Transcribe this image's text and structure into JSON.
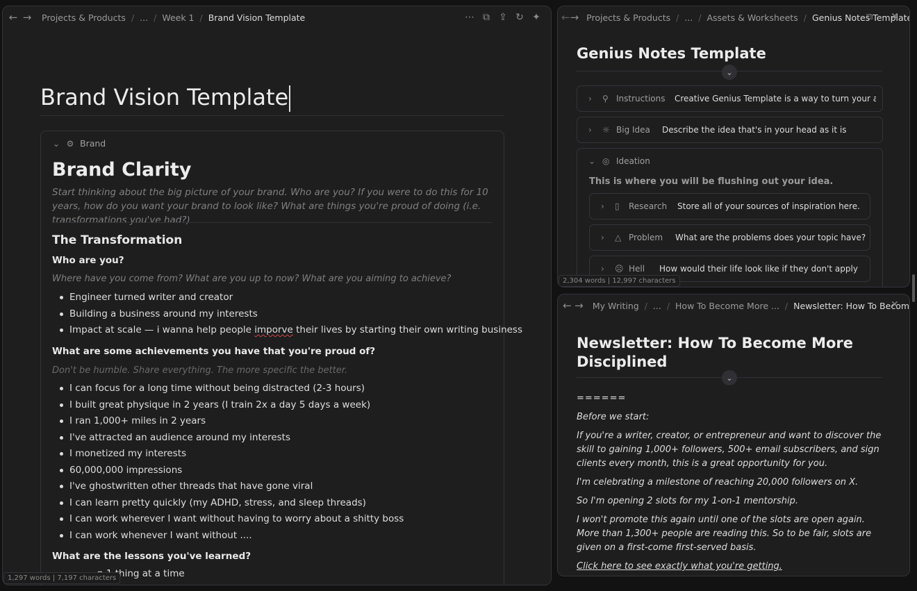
{
  "left": {
    "breadcrumb": [
      "Projects & Products",
      "...",
      "Week 1",
      "Brand Vision Template"
    ],
    "title": "Brand Vision Template",
    "callout_label": "Brand",
    "heading": "Brand Clarity",
    "intro": "Start thinking about the big picture of your brand. Who are you? If you were to do this for 10 years, how do you want your brand to look like? What are things you're proud of doing (i.e. transformations you've had?)",
    "section": "The Transformation",
    "q1": "Who are you?",
    "q1_hint": "Where have you come from? What are you up to now? What are you aiming to achieve?",
    "q1_items": [
      "Engineer turned writer and creator",
      "Building a business around my interests",
      "Impact at scale — i wanna help people imporve their lives by starting their own writing business"
    ],
    "q2": "What are some achievements you have that you're proud of?",
    "q2_hint": "Don't be humble. Share everything. The more specific the better.",
    "q2_items": [
      "I can focus for a long time without being distracted (2-3 hours)",
      "I built great physique in 2 years (I train 2x a day 5 days a week)",
      "I ran 1,000+ miles in 2 years",
      "I've attracted an audience around my interests",
      "I monetized my interests",
      "60,000,000 impressions",
      "I've ghostwritten other threads that have gone viral",
      "I can learn pretty quickly (my ADHD, stress, and sleep threads)",
      "I can work wherever I want without having to worry about a shitty boss",
      "I can work whenever I want without ...."
    ],
    "q3": "What are the lessons you've learned?",
    "q3_item_partial": "n 1 thing at a time",
    "status": "1,297 words | 7,197 characters"
  },
  "right_top": {
    "breadcrumb": [
      "Projects & Products",
      "...",
      "Assets & Worksheets",
      "Genius Notes Template"
    ],
    "title": "Genius Notes Template",
    "props": [
      {
        "name": "Instructions",
        "value": "Creative Genius Template is a way to turn your abstr...",
        "icon": "wand-icon"
      },
      {
        "name": "Big Idea",
        "value": "Describe the idea that's in your head as it is",
        "icon": "bulb-icon"
      }
    ],
    "ideation": {
      "name": "Ideation",
      "desc": "This is where you will be flushing out your idea.",
      "children": [
        {
          "name": "Research",
          "value": "Store all of your sources of inspiration here.",
          "icon": "book-icon"
        },
        {
          "name": "Problem",
          "value": "What are the problems does your topic have?",
          "icon": "warning-icon"
        },
        {
          "name": "Hell",
          "value": "How would their life look like if they don't apply the ...",
          "icon": "sad-face-icon"
        }
      ]
    },
    "status": "2,304 words | 12,997 characters"
  },
  "right_bottom": {
    "breadcrumb": [
      "My Writing",
      "...",
      "How To Become More ...",
      "Newsletter: How To Become Mo"
    ],
    "title_line1": "Newsletter: How To Become More",
    "title_line2": "Disciplined",
    "divider_text": "======",
    "paras": [
      "Before we start:",
      "If you're a writer, creator, or entrepreneur and want to discover the skill to gaining 1,000+ followers, 500+ email subscribers, and sign clients every month, this is a great opportunity for you.",
      "I'm celebrating a milestone of reaching 20,000 followers on X.",
      "So I'm opening 2 slots for my 1-on-1 mentorship.",
      "I won't promote this again until one of the slots are open again. More than 1,300+ people are reading this. So to be fair, slots are given on a first-come first-served basis."
    ],
    "link": "Click here to see exactly what you're getting."
  }
}
